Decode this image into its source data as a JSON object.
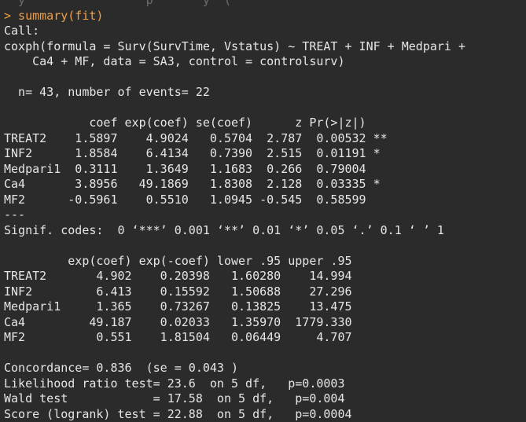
{
  "theme": {
    "background": "#2b2b2b",
    "output_text": "#e6e6e6",
    "command_text": "#f0a048"
  },
  "console": {
    "lines": [
      {
        "kind": "faded",
        "text": "  y                 p       y  ("
      },
      {
        "kind": "cmd",
        "text": "> summary(fit)"
      },
      {
        "kind": "out",
        "text": "Call:"
      },
      {
        "kind": "out",
        "text": "coxph(formula = Surv(SurvTime, Vstatus) ~ TREAT + INF + Medpari +"
      },
      {
        "kind": "out",
        "text": "    Ca4 + MF, data = SA3, control = controlsurv)"
      },
      {
        "kind": "out",
        "text": ""
      },
      {
        "kind": "out",
        "text": "  n= 43, number of events= 22"
      },
      {
        "kind": "out",
        "text": ""
      },
      {
        "kind": "out",
        "text": "            coef exp(coef) se(coef)      z Pr(>|z|)"
      },
      {
        "kind": "out",
        "text": "TREAT2    1.5897    4.9024   0.5704  2.787  0.00532 **"
      },
      {
        "kind": "out",
        "text": "INF2      1.8584    6.4134   0.7390  2.515  0.01191 *"
      },
      {
        "kind": "out",
        "text": "Medpari1  0.3111    1.3649   1.1683  0.266  0.79004"
      },
      {
        "kind": "out",
        "text": "Ca4       3.8956   49.1869   1.8308  2.128  0.03335 *"
      },
      {
        "kind": "out",
        "text": "MF2      -0.5961    0.5510   1.0945 -0.545  0.58599"
      },
      {
        "kind": "out",
        "text": "---"
      },
      {
        "kind": "out",
        "text": "Signif. codes:  0 ‘***’ 0.001 ‘**’ 0.01 ‘*’ 0.05 ‘.’ 0.1 ‘ ’ 1"
      },
      {
        "kind": "out",
        "text": ""
      },
      {
        "kind": "out",
        "text": "         exp(coef) exp(-coef) lower .95 upper .95"
      },
      {
        "kind": "out",
        "text": "TREAT2       4.902    0.20398   1.60280    14.994"
      },
      {
        "kind": "out",
        "text": "INF2         6.413    0.15592   1.50688    27.296"
      },
      {
        "kind": "out",
        "text": "Medpari1     1.365    0.73267   0.13825    13.475"
      },
      {
        "kind": "out",
        "text": "Ca4         49.187    0.02033   1.35970  1779.330"
      },
      {
        "kind": "out",
        "text": "MF2          0.551    1.81504   0.06449     4.707"
      },
      {
        "kind": "out",
        "text": ""
      },
      {
        "kind": "out",
        "text": "Concordance= 0.836  (se = 0.043 )"
      },
      {
        "kind": "out",
        "text": "Likelihood ratio test= 23.6  on 5 df,   p=0.0003"
      },
      {
        "kind": "out",
        "text": "Wald test            = 17.58  on 5 df,   p=0.004"
      },
      {
        "kind": "out",
        "text": "Score (logrank) test = 22.88  on 5 df,   p=0.0004"
      }
    ]
  }
}
